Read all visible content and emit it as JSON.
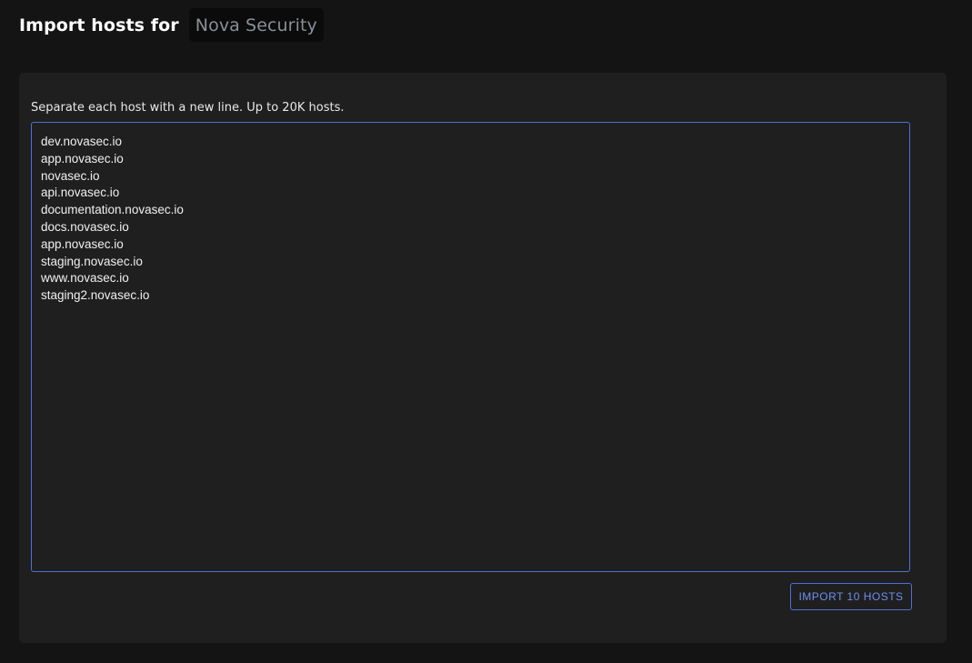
{
  "header": {
    "title": "Import hosts for",
    "organization": "Nova Security"
  },
  "form": {
    "instructions": "Separate each host with a new line. Up to 20K hosts.",
    "hosts": [
      "dev.novasec.io",
      "app.novasec.io",
      "novasec.io",
      "api.novasec.io",
      "documentation.novasec.io",
      "docs.novasec.io",
      "app.novasec.io",
      "staging.novasec.io",
      "www.novasec.io",
      "staging2.novasec.io"
    ],
    "import_button_label": "IMPORT 10 HOSTS"
  },
  "colors": {
    "background": "#141414",
    "panel": "#1f1f1f",
    "accent": "#4f6fd6",
    "muted_text": "#8a8e96"
  }
}
